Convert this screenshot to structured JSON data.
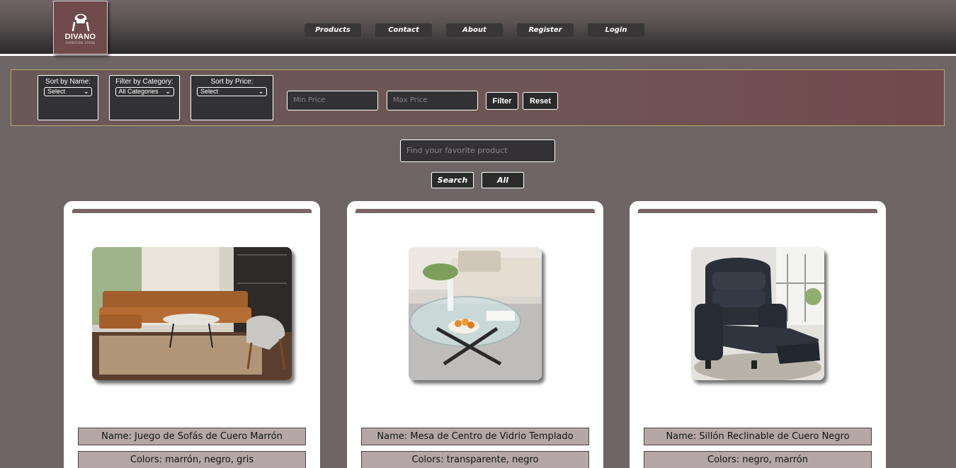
{
  "header": {
    "logo": {
      "title": "DIVANO",
      "subtitle": "FURNITURE STORE"
    },
    "nav": [
      "Products",
      "Contact",
      "About",
      "Register",
      "Login"
    ]
  },
  "filters": {
    "sort_name": {
      "label": "Sort by Name:",
      "value": "Select"
    },
    "category": {
      "label": "Filter by Category:",
      "value": "All Categories"
    },
    "sort_price": {
      "label": "Sort by Price:",
      "value": "Select"
    },
    "min_price_placeholder": "Min Price",
    "max_price_placeholder": "Max Price",
    "filter_label": "Filter",
    "reset_label": "Reset"
  },
  "search": {
    "placeholder": "Find your favorite product",
    "search_label": "Search",
    "all_label": "All"
  },
  "products": [
    {
      "name": "Name: Juego de Sofás de Cuero Marrón",
      "colors": "Colors: marrón, negro, gris",
      "image": "sofa-image"
    },
    {
      "name": "Name: Mesa de Centro de Vidrio Templado",
      "colors": "Colors: transparente, negro",
      "image": "coffee-table-image"
    },
    {
      "name": "Name: Sillón Reclinable de Cuero Negro",
      "colors": "Colors: negro, marrón",
      "image": "recliner-image"
    }
  ]
}
